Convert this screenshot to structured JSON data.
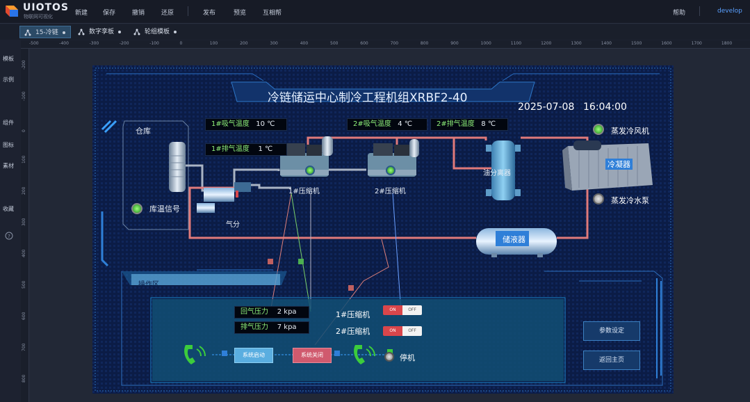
{
  "app": {
    "brand": "UIOTOS",
    "brand_sub": "物联网可视化",
    "user": "develop",
    "help": "帮助"
  },
  "menu": [
    "新建",
    "保存",
    "撤销",
    "还原",
    "发布",
    "预览",
    "互相帮"
  ],
  "tabs": [
    {
      "label": "15-冷链",
      "active": true
    },
    {
      "label": "数字孪板",
      "active": false
    },
    {
      "label": "轮组模板",
      "active": false
    }
  ],
  "left_nav": [
    "文件",
    "模板",
    "示例",
    "组件",
    "图标",
    "素材",
    "收藏"
  ],
  "ruler_h": [
    "-500",
    "-400",
    "-300",
    "-200",
    "-100",
    "0",
    "100",
    "200",
    "300",
    "400",
    "500",
    "600",
    "700",
    "800",
    "900",
    "1000",
    "1100",
    "1200",
    "1300",
    "1400",
    "1500",
    "1600",
    "1700",
    "1800"
  ],
  "ruler_v": [
    "-200",
    "-100",
    "0",
    "100",
    "200",
    "300",
    "400",
    "500",
    "600",
    "700",
    "800"
  ],
  "scada": {
    "title": "冷链储运中心制冷工程机组XRBF2-40",
    "date": "2025-07-08",
    "time": "16:04:00",
    "warehouse": "仓库",
    "temp_signal": "库温信号",
    "gas_separator": "气分",
    "oil_separator": "油分离器",
    "condenser": "冷凝器",
    "receiver": "储液器",
    "compressor1": "1#压缩机",
    "compressor2": "2#压缩机",
    "evap_fan": "蒸发冷风机",
    "evap_pump": "蒸发冷水泵",
    "sensors": [
      {
        "label": "1#吸气温度",
        "value": "10",
        "unit": "℃"
      },
      {
        "label": "1#排气温度",
        "value": "1",
        "unit": "℃"
      },
      {
        "label": "2#吸气温度",
        "value": "4",
        "unit": "℃"
      },
      {
        "label": "2#排气温度",
        "value": "8",
        "unit": "℃"
      }
    ],
    "op_area": "操作区",
    "pressures": [
      {
        "label": "回气压力",
        "value": "2",
        "unit": "kpa"
      },
      {
        "label": "排气压力",
        "value": "7",
        "unit": "kpa"
      }
    ],
    "switches": [
      {
        "label": "1#压缩机",
        "on": "ON",
        "off": "OFF"
      },
      {
        "label": "2#压缩机",
        "on": "ON",
        "off": "OFF"
      }
    ],
    "btn_start": "系统启动",
    "btn_stop": "系统关闭",
    "stop_label": "停机",
    "btn_params": "参数设定",
    "btn_home": "返回主页",
    "colors": {
      "pipe_red": "#e07a7a",
      "pipe_gray": "#aab4c4",
      "accent": "#3aa0ff",
      "led_green": "#3ccc3c"
    }
  }
}
